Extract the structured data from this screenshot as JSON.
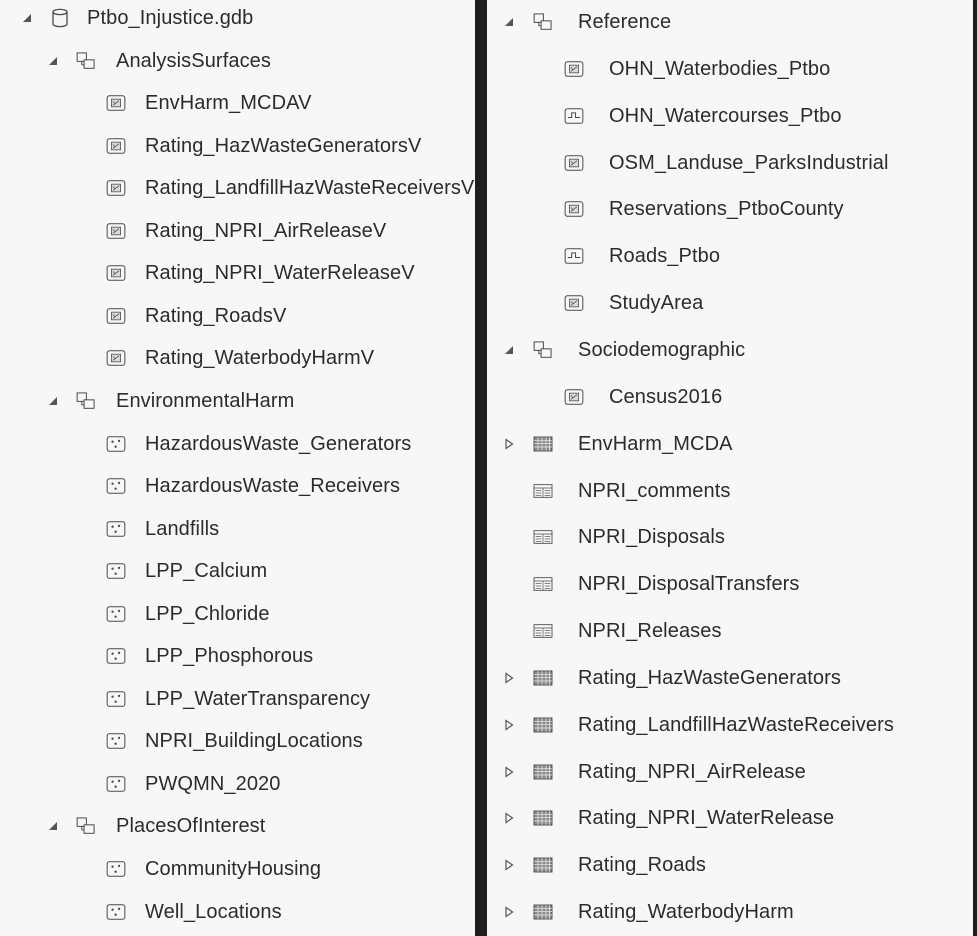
{
  "left_panel": {
    "root": {
      "label": "Ptbo_Injustice.gdb",
      "icon": "database-icon",
      "expanded": true
    },
    "datasets": [
      {
        "label": "AnalysisSurfaces",
        "icon": "feature-dataset-icon",
        "expanded": true,
        "items": [
          {
            "label": "EnvHarm_MCDAV",
            "icon": "polygon-feature-class-icon"
          },
          {
            "label": "Rating_HazWasteGeneratorsV",
            "icon": "polygon-feature-class-icon"
          },
          {
            "label": "Rating_LandfillHazWasteReceiversV",
            "icon": "polygon-feature-class-icon"
          },
          {
            "label": "Rating_NPRI_AirReleaseV",
            "icon": "polygon-feature-class-icon"
          },
          {
            "label": "Rating_NPRI_WaterReleaseV",
            "icon": "polygon-feature-class-icon"
          },
          {
            "label": "Rating_RoadsV",
            "icon": "polygon-feature-class-icon"
          },
          {
            "label": "Rating_WaterbodyHarmV",
            "icon": "polygon-feature-class-icon"
          }
        ]
      },
      {
        "label": "EnvironmentalHarm",
        "icon": "feature-dataset-icon",
        "expanded": true,
        "items": [
          {
            "label": "HazardousWaste_Generators",
            "icon": "point-feature-class-icon"
          },
          {
            "label": "HazardousWaste_Receivers",
            "icon": "point-feature-class-icon"
          },
          {
            "label": "Landfills",
            "icon": "point-feature-class-icon"
          },
          {
            "label": "LPP_Calcium",
            "icon": "point-feature-class-icon"
          },
          {
            "label": "LPP_Chloride",
            "icon": "point-feature-class-icon"
          },
          {
            "label": "LPP_Phosphorous",
            "icon": "point-feature-class-icon"
          },
          {
            "label": "LPP_WaterTransparency",
            "icon": "point-feature-class-icon"
          },
          {
            "label": "NPRI_BuildingLocations",
            "icon": "point-feature-class-icon"
          },
          {
            "label": "PWQMN_2020",
            "icon": "point-feature-class-icon"
          }
        ]
      },
      {
        "label": "PlacesOfInterest",
        "icon": "feature-dataset-icon",
        "expanded": true,
        "items": [
          {
            "label": "CommunityHousing",
            "icon": "point-feature-class-icon"
          },
          {
            "label": "Well_Locations",
            "icon": "point-feature-class-icon"
          }
        ]
      }
    ]
  },
  "right_panel": {
    "datasets": [
      {
        "label": "Reference",
        "icon": "feature-dataset-icon",
        "expanded": true,
        "items": [
          {
            "label": "OHN_Waterbodies_Ptbo",
            "icon": "polygon-feature-class-icon"
          },
          {
            "label": "OHN_Watercourses_Ptbo",
            "icon": "line-feature-class-icon"
          },
          {
            "label": "OSM_Landuse_ParksIndustrial",
            "icon": "polygon-feature-class-icon"
          },
          {
            "label": "Reservations_PtboCounty",
            "icon": "polygon-feature-class-icon"
          },
          {
            "label": "Roads_Ptbo",
            "icon": "line-feature-class-icon"
          },
          {
            "label": "StudyArea",
            "icon": "polygon-feature-class-icon"
          }
        ]
      },
      {
        "label": "Sociodemographic",
        "icon": "feature-dataset-icon",
        "expanded": true,
        "items": [
          {
            "label": "Census2016",
            "icon": "polygon-feature-class-icon"
          }
        ]
      }
    ],
    "top_items": [
      {
        "label": "EnvHarm_MCDA",
        "icon": "raster-grid-icon",
        "expandable": true
      },
      {
        "label": "NPRI_comments",
        "icon": "table-icon",
        "expandable": false
      },
      {
        "label": "NPRI_Disposals",
        "icon": "table-icon",
        "expandable": false
      },
      {
        "label": "NPRI_DisposalTransfers",
        "icon": "table-icon",
        "expandable": false
      },
      {
        "label": "NPRI_Releases",
        "icon": "table-icon",
        "expandable": false
      },
      {
        "label": "Rating_HazWasteGenerators",
        "icon": "raster-grid-icon",
        "expandable": true
      },
      {
        "label": "Rating_LandfillHazWasteReceivers",
        "icon": "raster-grid-icon",
        "expandable": true
      },
      {
        "label": "Rating_NPRI_AirRelease",
        "icon": "raster-grid-icon",
        "expandable": true
      },
      {
        "label": "Rating_NPRI_WaterRelease",
        "icon": "raster-grid-icon",
        "expandable": true
      },
      {
        "label": "Rating_Roads",
        "icon": "raster-grid-icon",
        "expandable": true
      },
      {
        "label": "Rating_WaterbodyHarm",
        "icon": "raster-grid-icon",
        "expandable": true
      }
    ]
  },
  "colors": {
    "panel_bg": "#f7f7f7",
    "divider": "#1f1f1f",
    "text": "#2b2b2b",
    "icon_stroke": "#4a4a4a",
    "toggle": "#555555"
  }
}
